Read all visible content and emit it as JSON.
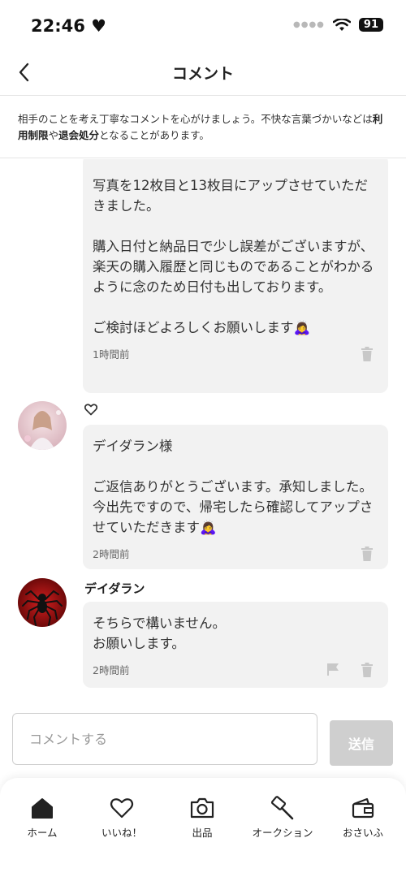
{
  "status": {
    "time": "22:46",
    "battery": "91"
  },
  "header": {
    "title": "コメント"
  },
  "notice": {
    "part1": "相手のことを考え丁寧なコメントを心がけましょう。不快な言葉づかいなどは",
    "bold1": "利用制限",
    "part2": "や",
    "bold2": "退会処分",
    "part3": "となることがあります。"
  },
  "comments": [
    {
      "text": "写真を12枚目と13枚目にアップさせていただきました。\n\n購入日付と納品日で少し誤差がございますが、楽天の購入履歴と同じものであることがわかるように念のため日付も出しております。\n\nご検討ほどよろしくお願いします🙇‍♀️",
      "time": "1時間前"
    },
    {
      "name": "",
      "text": "デイダラン様\n\nご返信ありがとうございます。承知しました。今出先ですので、帰宅したら確認してアップさせていただきます🙇‍♀️",
      "time": "2時間前"
    },
    {
      "name": "デイダラン",
      "text": "そちらで構いません。\nお願いします。",
      "time": "2時間前"
    }
  ],
  "input": {
    "placeholder": "コメントする",
    "send_label": "送信"
  },
  "tabs": [
    {
      "label": "ホーム",
      "icon": "home-icon"
    },
    {
      "label": "いいね！",
      "icon": "heart-icon"
    },
    {
      "label": "出品",
      "icon": "camera-icon"
    },
    {
      "label": "オークション",
      "icon": "hammer-icon"
    },
    {
      "label": "おさいふ",
      "icon": "wallet-icon"
    }
  ],
  "colors": {
    "bubble": "#f2f2f2",
    "send_disabled": "#cfcfcf",
    "text": "#222222"
  }
}
